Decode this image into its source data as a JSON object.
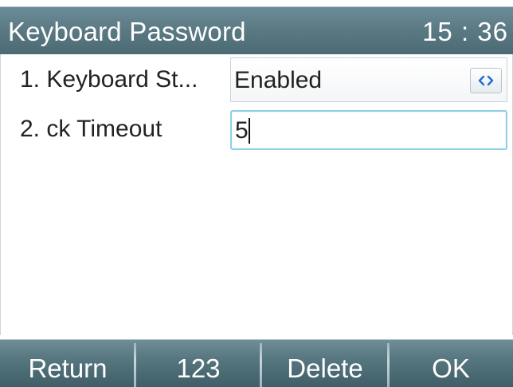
{
  "titlebar": {
    "title": "Keyboard Password",
    "clock": "15 : 36"
  },
  "fields": [
    {
      "index": "1.",
      "label": "1.  Keyboard St...",
      "value": "Enabled",
      "control": "select",
      "switch_icon": "left-right-arrows-icon"
    },
    {
      "index": "2.",
      "label": "2.  ck Timeout",
      "value": "5",
      "control": "text-input"
    }
  ],
  "softkeys": {
    "return_label": "Return",
    "input_mode_label": "123",
    "delete_label": "Delete",
    "ok_label": "OK"
  },
  "colors": {
    "titlebar": "#5a7983",
    "softkey_bar": "#567680",
    "input_focus_border": "#8fd0e6",
    "switch_arrow": "#1b6fd6"
  }
}
